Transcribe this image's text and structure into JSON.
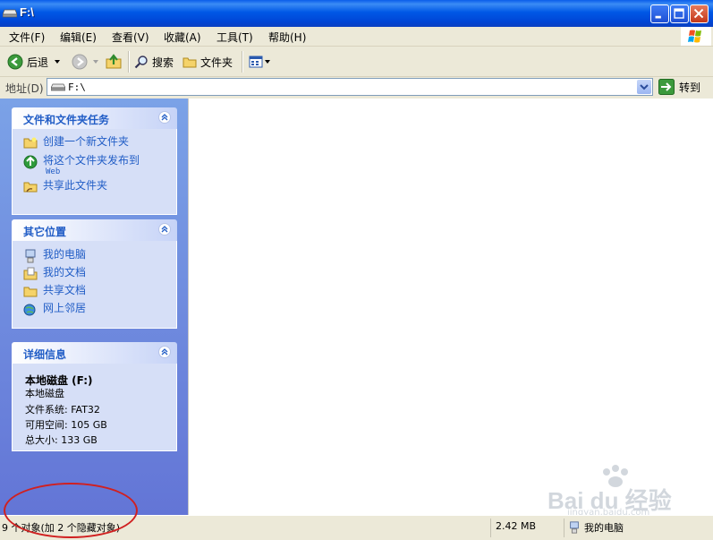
{
  "window": {
    "title": "F:\\",
    "minimize_icon": "minimize-icon",
    "maximize_icon": "maximize-icon",
    "close_icon": "close-icon"
  },
  "menu": [
    "文件(F)",
    "编辑(E)",
    "查看(V)",
    "收藏(A)",
    "工具(T)",
    "帮助(H)"
  ],
  "toolbar": {
    "back": "后退",
    "search": "搜索",
    "folders": "文件夹"
  },
  "address": {
    "label": "地址(D)",
    "value": "F:\\",
    "go": "转到"
  },
  "tasks_panel": {
    "title": "文件和文件夹任务",
    "items": [
      {
        "label": "创建一个新文件夹",
        "icon": "new-folder-icon"
      },
      {
        "label": "将这个文件夹发布到",
        "sub": "Web",
        "icon": "publish-web-icon"
      },
      {
        "label": "共享此文件夹",
        "icon": "share-folder-icon"
      }
    ]
  },
  "places_panel": {
    "title": "其它位置",
    "items": [
      {
        "label": "我的电脑",
        "icon": "my-computer-icon"
      },
      {
        "label": "我的文档",
        "icon": "my-documents-icon"
      },
      {
        "label": "共享文档",
        "icon": "shared-documents-icon"
      },
      {
        "label": "网上邻居",
        "icon": "network-places-icon"
      }
    ]
  },
  "details_panel": {
    "title": "详细信息",
    "name": "本地磁盘 (F:)",
    "type": "本地磁盘",
    "filesystem": "文件系统: FAT32",
    "free": "可用空间: 105 GB",
    "total": "总大小: 133 GB"
  },
  "status": {
    "objects": "9 个对象(加 2 个隐藏对象)",
    "size": "2.42 MB",
    "location": "我的电脑"
  },
  "watermark": {
    "brand": "Bai du 经验",
    "url": "jingyan.baidu.com"
  },
  "colors": {
    "titlebar": "#0058E6",
    "pane": "#6375D6",
    "link": "#215DC6",
    "annotation": "#D02020"
  }
}
